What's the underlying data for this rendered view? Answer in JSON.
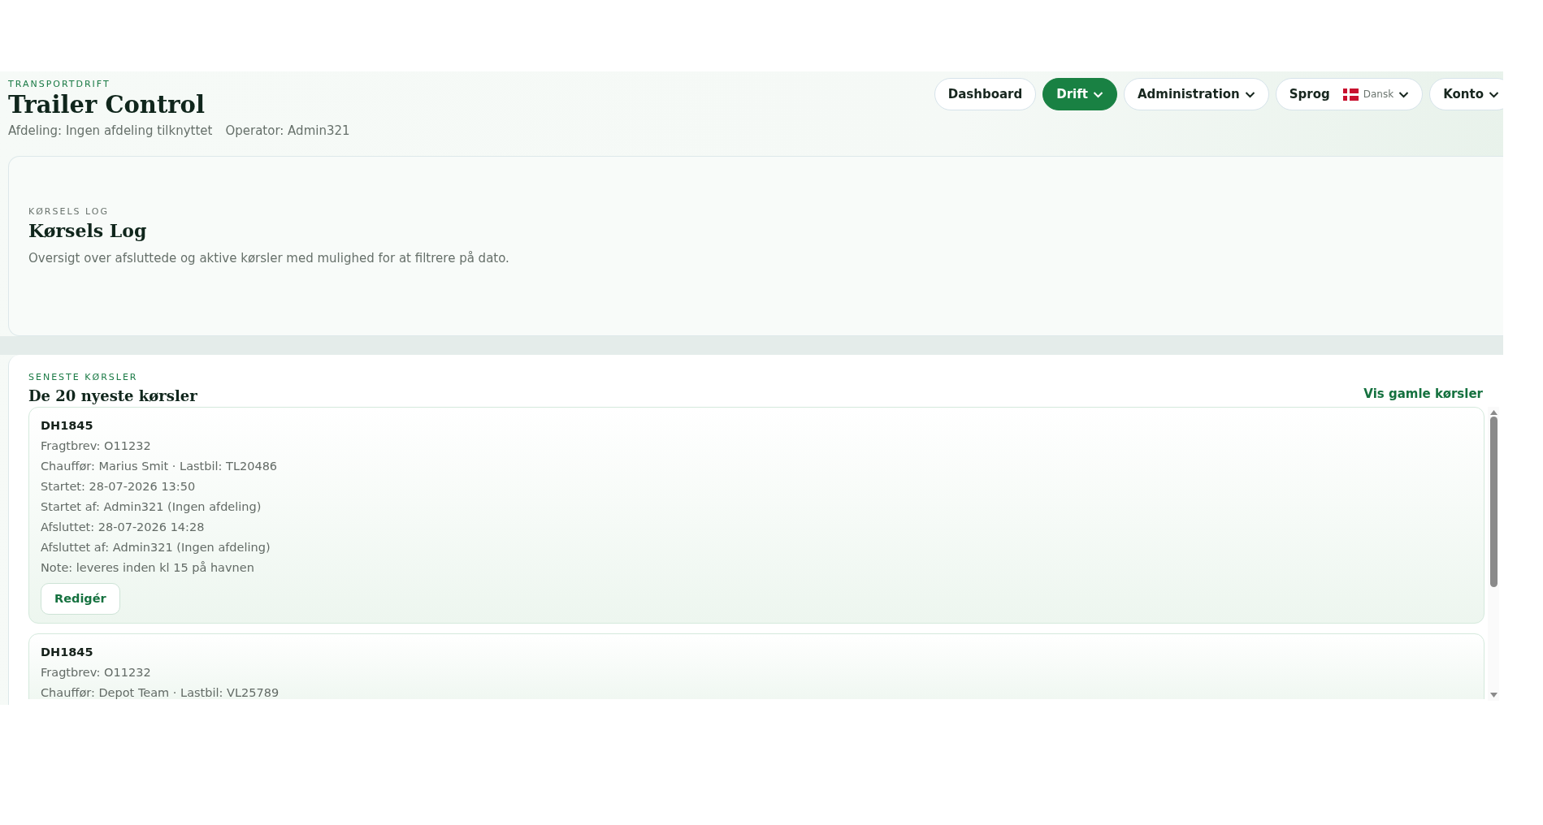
{
  "header": {
    "eyebrow": "TRANSPORTDRIFT",
    "title": "Trailer Control",
    "meta": [
      "Afdeling: Ingen afdeling tilknyttet",
      "Operator: Admin321"
    ]
  },
  "nav": [
    {
      "label": "Dashboard",
      "kind": "link",
      "selected": false
    },
    {
      "label": "Drift",
      "kind": "dropdown",
      "selected": true
    },
    {
      "label": "Administration",
      "kind": "dropdown",
      "selected": false
    },
    {
      "label": "Sprog",
      "kind": "language",
      "selected": false,
      "value": "Dansk"
    },
    {
      "label": "Konto",
      "kind": "dropdown",
      "selected": false
    }
  ],
  "hero": {
    "eyebrow": "KØRSELS LOG",
    "title": "Kørsels Log",
    "description": "Oversigt over afsluttede og aktive kørsler med mulighed for at filtrere på dato."
  },
  "section": {
    "eyebrow": "SENESTE KØRSLER",
    "title": "De 20 nyeste kørsler",
    "link": "Vis gamle kørsler",
    "trips": [
      {
        "id": "DH1845",
        "lines": [
          "Fragtbrev: O11232",
          "Chauffør: Marius Smit · Lastbil: TL20486",
          "Startet: 28-07-2026 13:50",
          "Startet af: Admin321 (Ingen afdeling)",
          "Afsluttet: 28-07-2026 14:28",
          "Afsluttet af: Admin321 (Ingen afdeling)",
          "Note: leveres inden kl 15 på havnen"
        ],
        "button": "Redigér"
      },
      {
        "id": "DH1845",
        "lines": [
          "Fragtbrev: O11232",
          "Chauffør: Depot Team · Lastbil: VL25789"
        ]
      }
    ]
  }
}
